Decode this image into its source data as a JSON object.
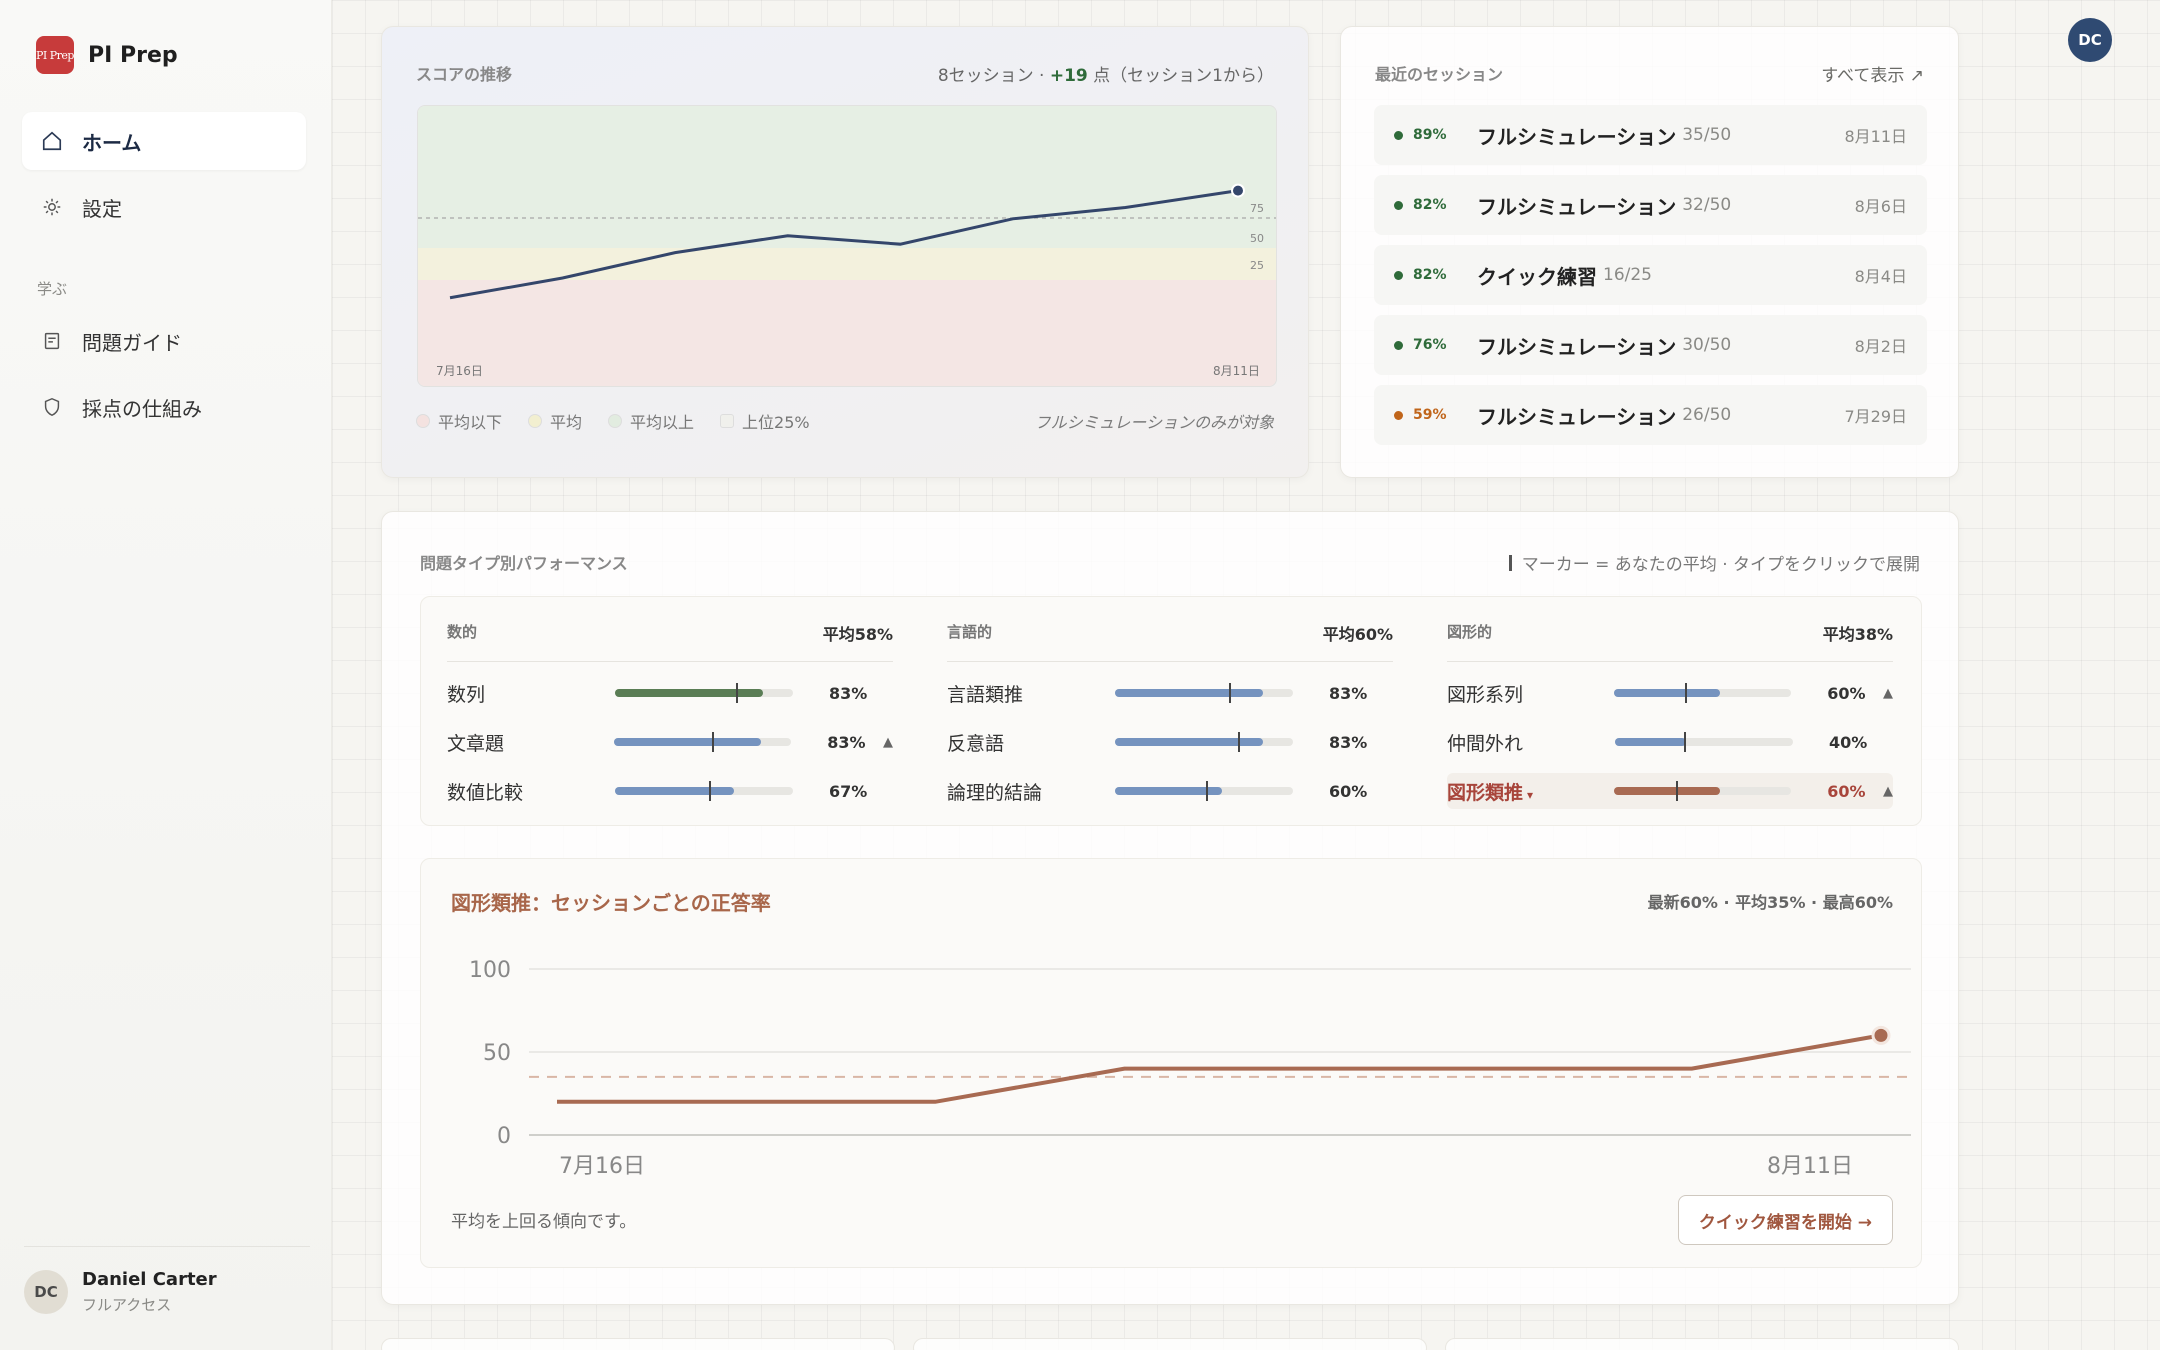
{
  "brand": {
    "logo_text": "PI Prep",
    "name": "PI Prep"
  },
  "nav": {
    "home": "ホーム",
    "settings": "設定",
    "section_learn": "学ぶ",
    "question_guide": "問題ガイド",
    "scoring": "採点の仕組み"
  },
  "user": {
    "initials": "DC",
    "name": "Daniel Carter",
    "plan": "フルアクセス"
  },
  "score_card": {
    "title": "スコアの推移",
    "summary_prefix": "8セッション · ",
    "summary_delta": "+19",
    "summary_suffix": " 点（セッション1から）",
    "x_start": "7月16日",
    "x_end": "8月11日",
    "band_labels": [
      "75",
      "50",
      "25"
    ],
    "legend": [
      "平均以下",
      "平均",
      "平均以上",
      "上位25%"
    ],
    "note": "フルシミュレーションのみが対象"
  },
  "chart_data": [
    {
      "type": "line",
      "title": "スコアの推移",
      "x": [
        "7月16日",
        "",
        "",
        "",
        "",
        "",
        "",
        "8月11日"
      ],
      "series": [
        {
          "values": [
            32,
            39,
            48,
            54,
            51,
            60,
            64,
            70
          ]
        }
      ],
      "band_ticks": [
        25,
        50,
        75
      ],
      "ylim": [
        0,
        100
      ],
      "grid": false
    },
    {
      "type": "line",
      "title": "図形類推：セッションごとの正答率",
      "x": [
        "7月16日",
        "",
        "",
        "",
        "",
        "",
        "",
        "8月11日"
      ],
      "series": [
        {
          "values": [
            20,
            20,
            20,
            40,
            40,
            40,
            40,
            60
          ]
        }
      ],
      "average_line": 35,
      "yticks": [
        0,
        50,
        100
      ],
      "ylim": [
        0,
        100
      ],
      "grid": true
    }
  ],
  "recent": {
    "title": "最近のセッション",
    "view_all": "すべて表示 ↗",
    "sessions": [
      {
        "pct": "89%",
        "name": "フルシミュレーション",
        "count": "35/50",
        "date": "8月11日",
        "color": "#2f6b3a"
      },
      {
        "pct": "82%",
        "name": "フルシミュレーション",
        "count": "32/50",
        "date": "8月6日",
        "color": "#2f6b3a"
      },
      {
        "pct": "82%",
        "name": "クイック練習",
        "count": "16/25",
        "date": "8月4日",
        "color": "#2f6b3a"
      },
      {
        "pct": "76%",
        "name": "フルシミュレーション",
        "count": "30/50",
        "date": "8月2日",
        "color": "#2f6b3a"
      },
      {
        "pct": "59%",
        "name": "フルシミュレーション",
        "count": "26/50",
        "date": "7月29日",
        "color": "#c0651a"
      }
    ]
  },
  "performance": {
    "title": "問題タイプ別パフォーマンス",
    "note": "マーカー = あなたの平均 · タイプをクリックで展開",
    "columns": [
      {
        "name": "数的",
        "avg": "平均58%",
        "rows": [
          {
            "label": "数列",
            "pct": "83%",
            "value": 0.83,
            "marker": 0.68,
            "trend": "",
            "color": "#5a7d55"
          },
          {
            "label": "文章題",
            "pct": "83%",
            "value": 0.83,
            "marker": 0.55,
            "trend": "▲",
            "color": "#7593bf"
          },
          {
            "label": "数値比較",
            "pct": "67%",
            "value": 0.67,
            "marker": 0.53,
            "trend": "",
            "color": "#7593bf"
          }
        ]
      },
      {
        "name": "言語的",
        "avg": "平均60%",
        "rows": [
          {
            "label": "言語類推",
            "pct": "83%",
            "value": 0.83,
            "marker": 0.64,
            "trend": "",
            "color": "#7593bf"
          },
          {
            "label": "反意語",
            "pct": "83%",
            "value": 0.83,
            "marker": 0.69,
            "trend": "",
            "color": "#7593bf"
          },
          {
            "label": "論理的結論",
            "pct": "60%",
            "value": 0.6,
            "marker": 0.51,
            "trend": "",
            "color": "#7593bf"
          }
        ]
      },
      {
        "name": "図形的",
        "avg": "平均38%",
        "rows": [
          {
            "label": "図形系列",
            "pct": "60%",
            "value": 0.6,
            "marker": 0.4,
            "trend": "▲",
            "color": "#7593bf"
          },
          {
            "label": "仲間外れ",
            "pct": "40%",
            "value": 0.4,
            "marker": 0.39,
            "trend": "",
            "color": "#7593bf"
          },
          {
            "label": "図形類推",
            "pct": "60%",
            "value": 0.6,
            "marker": 0.35,
            "trend": "▲",
            "color": "#a86a52",
            "highlight": true
          }
        ]
      }
    ],
    "detail": {
      "title": "図形類推：セッションごとの正答率",
      "stats": "最新60% · 平均35% · 最高60%",
      "x_start": "7月16日",
      "x_end": "8月11日",
      "foot": "平均を上回る傾向です。",
      "button": "クイック練習を開始 →"
    }
  }
}
